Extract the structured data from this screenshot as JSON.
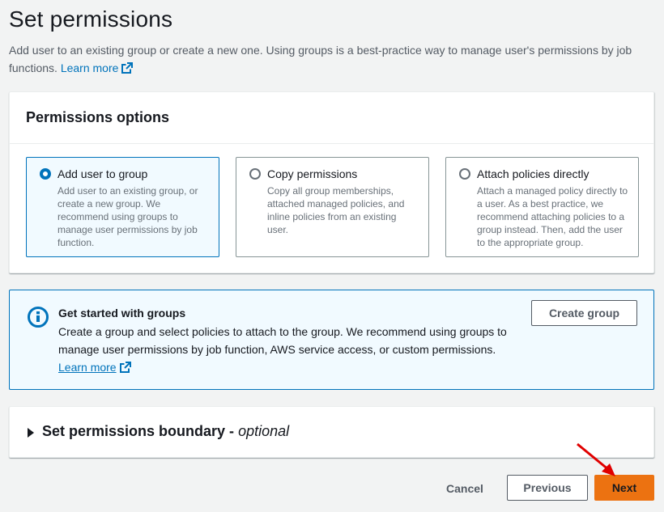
{
  "page": {
    "title": "Set permissions",
    "description": "Add user to an existing group or create a new one. Using groups is a best-practice way to manage user's permissions by job functions.",
    "learn_more": "Learn more"
  },
  "permissions_options": {
    "header": "Permissions options",
    "selected": "add-user-to-group",
    "options": [
      {
        "label": "Add user to group",
        "description": "Add user to an existing group, or create a new group. We recommend using groups to manage user permissions by job function."
      },
      {
        "label": "Copy permissions",
        "description": "Copy all group memberships, attached managed policies, and inline policies from an existing user."
      },
      {
        "label": "Attach policies directly",
        "description": "Attach a managed policy directly to a user. As a best practice, we recommend attaching policies to a group instead. Then, add the user to the appropriate group."
      }
    ]
  },
  "info_alert": {
    "heading": "Get started with groups",
    "body": "Create a group and select policies to attach to the group. We recommend using groups to manage user permissions by job function, AWS service access, or custom permissions.",
    "learn_more": "Learn more",
    "button": "Create group",
    "icon": "info-icon"
  },
  "boundary": {
    "label": "Set permissions boundary - ",
    "optional": "optional"
  },
  "footer": {
    "cancel": "Cancel",
    "previous": "Previous",
    "next": "Next"
  },
  "colors": {
    "link": "#0073bb",
    "selected_border": "#0073bb",
    "selected_bg": "#f1faff",
    "primary_button": "#ec7211",
    "annotation_arrow": "#e00000"
  }
}
